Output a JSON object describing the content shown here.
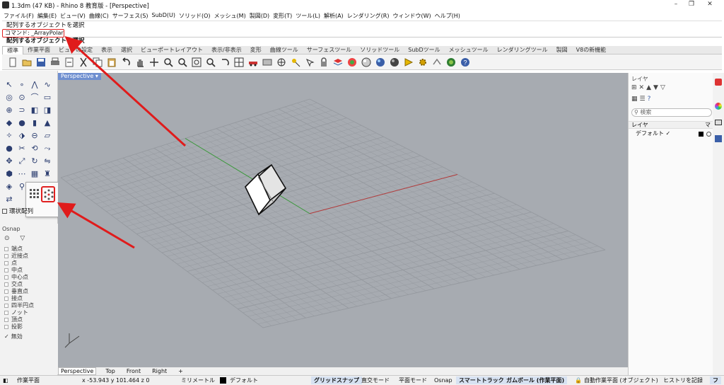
{
  "window": {
    "title": "1.3dm (47 KB) - Rhino 8 教育版 - [Perspective]",
    "controls": [
      "–",
      "❐",
      "✕"
    ]
  },
  "menu": [
    "ファイル(F)",
    "編集(E)",
    "ビュー(V)",
    "曲線(C)",
    "サーフェス(S)",
    "SubD(U)",
    "ソリッド(O)",
    "メッシュ(M)",
    "製図(D)",
    "変形(T)",
    "ツール(L)",
    "解析(A)",
    "レンダリング(R)",
    "ウィンドウ(W)",
    "ヘルプ(H)"
  ],
  "command": {
    "history": "配列するオブジェクトを選択",
    "current": "コマンド: _ArrayPolar",
    "prompt": "配列するオブジェクトを選択"
  },
  "tabs": [
    "標準",
    "作業平面",
    "ビューの設定",
    "表示",
    "選択",
    "ビューポートレイアウト",
    "表示/非表示",
    "変形",
    "曲線ツール",
    "サーフェスツール",
    "ソリッドツール",
    "SubDツール",
    "メッシュツール",
    "レンダリングツール",
    "製図",
    "V8の新機能"
  ],
  "flyout": {
    "tooltip": "環状配列"
  },
  "osnap": {
    "title": "Osnap",
    "items": [
      "端点",
      "近接点",
      "点",
      "中点",
      "中心点",
      "交点",
      "垂直点",
      "接点",
      "四半円点",
      "ノット",
      "頂点",
      "投影"
    ],
    "disable": "無効"
  },
  "viewport": {
    "title": "Perspective",
    "tabs": [
      "Perspective",
      "Top",
      "Front",
      "Right"
    ],
    "add": "+"
  },
  "layers": {
    "title": "レイヤ",
    "search_placeholder": "検索",
    "col_name": "レイヤ",
    "col_mat": "マ",
    "default_layer": "デフォルト",
    "check": "✓"
  },
  "status": {
    "cplane": "作業平面",
    "coords": "x -53.943   y 101.464   z 0",
    "units": "ミリメートル",
    "layer": "デフォルト",
    "grid_snap": "グリッドスナップ",
    "ortho": "直交モード",
    "planar": "平面モード",
    "osnap": "Osnap",
    "smarttrack": "スマートトラック",
    "gumball": "ガムボール (作業平面)",
    "autocplane": "自動作業平面 (オブジェクト)",
    "history": "ヒストリを記録",
    "filter": "フ"
  },
  "colors": {
    "viewport_bg": "#a7abb1",
    "grid": "#95999f",
    "x_axis": "#b33a3a",
    "y_axis": "#3a9a3a",
    "arrow": "#e01b1b",
    "active_tab": "#6f8fd0"
  }
}
